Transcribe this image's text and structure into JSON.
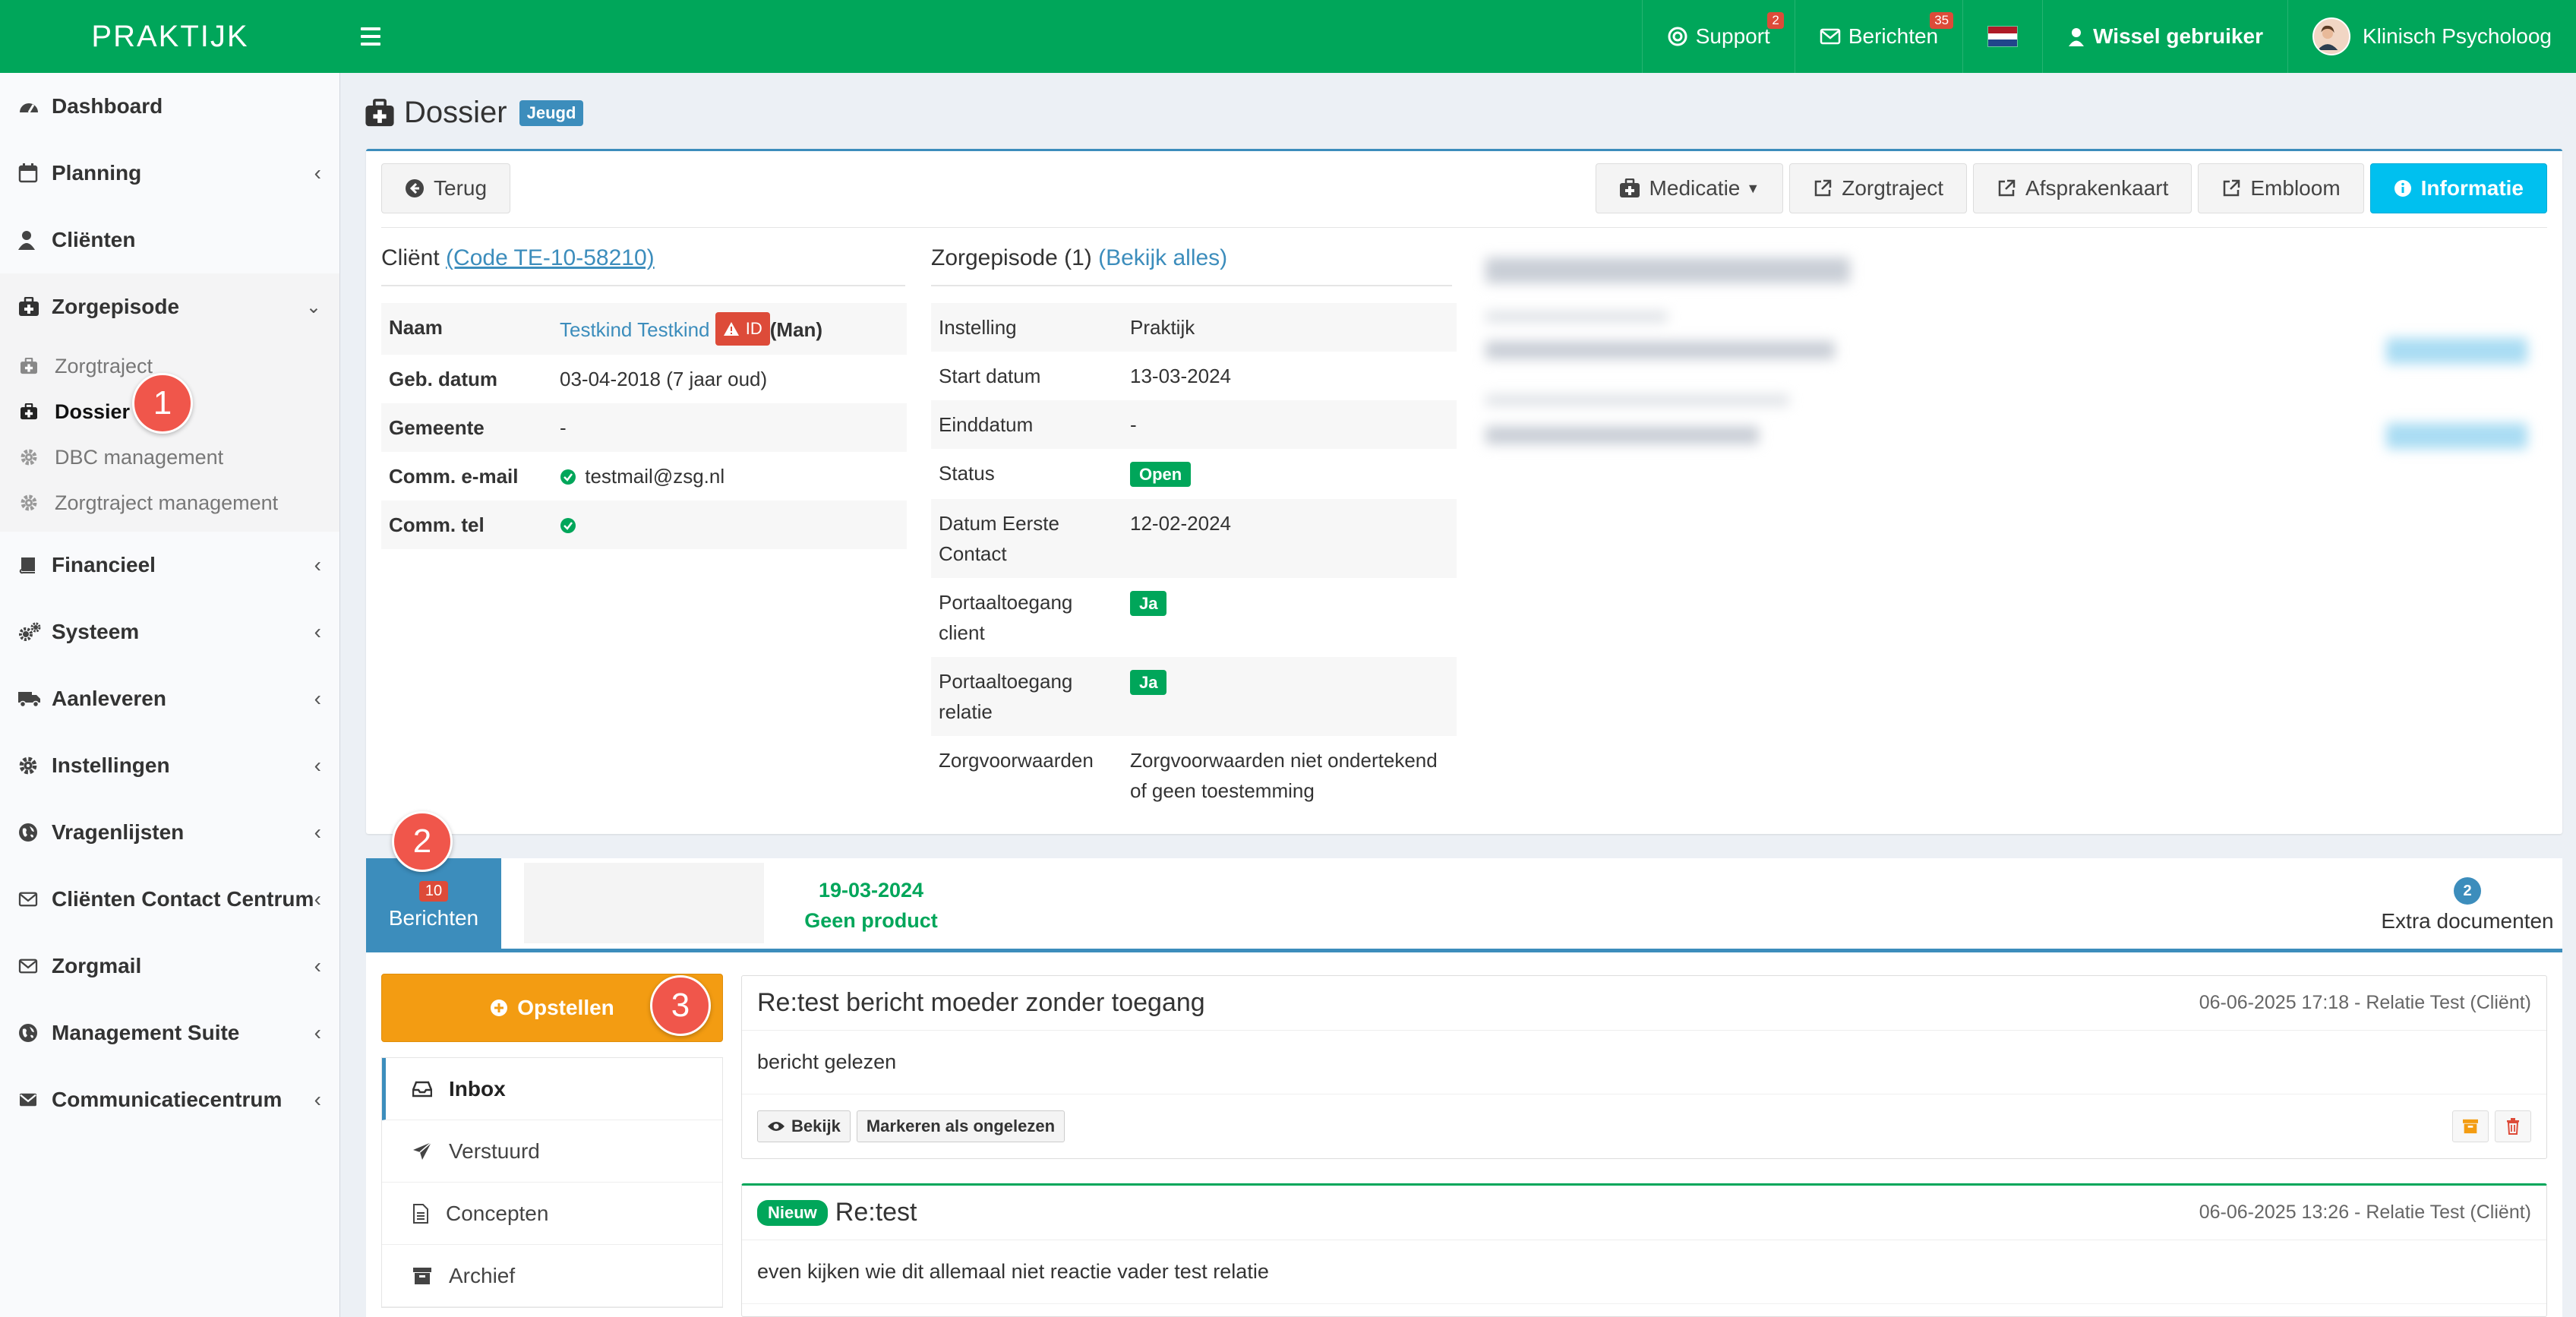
{
  "header": {
    "brand": "PRAKTIJK",
    "support_label": "Support",
    "support_badge": "2",
    "berichten_label": "Berichten",
    "berichten_badge": "35",
    "switch_user_label": "Wissel gebruiker",
    "user_role": "Klinisch Psycholoog"
  },
  "sidebar": {
    "items": [
      {
        "label": "Dashboard",
        "icon": "dashboard-icon"
      },
      {
        "label": "Planning",
        "icon": "calendar-icon"
      },
      {
        "label": "Cliënten",
        "icon": "user-icon"
      },
      {
        "label": "Zorgepisode",
        "icon": "medkit-icon"
      },
      {
        "label": "Financieel",
        "icon": "book-icon"
      },
      {
        "label": "Systeem",
        "icon": "cogs-icon"
      },
      {
        "label": "Aanleveren",
        "icon": "truck-icon"
      },
      {
        "label": "Instellingen",
        "icon": "gear-icon"
      },
      {
        "label": "Vragenlijsten",
        "icon": "globe-icon"
      },
      {
        "label": "Cliënten Contact Centrum",
        "icon": "envelope-icon"
      },
      {
        "label": "Zorgmail",
        "icon": "envelope-icon"
      },
      {
        "label": "Management Suite",
        "icon": "globe-icon"
      },
      {
        "label": "Communicatiecentrum",
        "icon": "envelope-icon"
      }
    ],
    "subitems": [
      {
        "label": "Zorgtraject"
      },
      {
        "label": "Dossier"
      },
      {
        "label": "DBC management"
      },
      {
        "label": "Zorgtraject management"
      }
    ]
  },
  "steps": [
    "1",
    "2",
    "3"
  ],
  "page": {
    "title": "Dossier",
    "label": "Jeugd"
  },
  "toolbar": {
    "back": "Terug",
    "medicatie": "Medicatie",
    "zorgtraject": "Zorgtraject",
    "afsprakenkaart": "Afsprakenkaart",
    "embloom": "Embloom",
    "informatie": "Informatie"
  },
  "client": {
    "title": "Cliënt",
    "code": "(Code TE-10-58210)",
    "rows": [
      {
        "label": "Naam",
        "value": "Testkind Testkind"
      },
      {
        "label": "Geb. datum",
        "value": "03-04-2018 (7 jaar oud)"
      },
      {
        "label": "Gemeente",
        "value": "-"
      },
      {
        "label": "Comm. e-mail",
        "value": "testmail@zsg.nl"
      },
      {
        "label": "Comm. tel",
        "value": ""
      }
    ],
    "id_badge": "ID",
    "gender": "(Man)"
  },
  "zorgepisode": {
    "title": "Zorgepisode (1)",
    "link": "(Bekijk alles)",
    "rows": [
      {
        "label": "Instelling",
        "value": "Praktijk"
      },
      {
        "label": "Start datum",
        "value": "13-03-2024"
      },
      {
        "label": "Einddatum",
        "value": "-"
      },
      {
        "label": "Status",
        "value": "Open"
      },
      {
        "label": "Datum Eerste Contact",
        "value": "12-02-2024"
      },
      {
        "label": "Portaaltoegang client",
        "value": "Ja"
      },
      {
        "label": "Portaaltoegang relatie",
        "value": "Ja"
      },
      {
        "label": "Zorgvoorwaarden",
        "value": "Zorgvoorwaarden niet ondertekend of geen toestemming"
      }
    ]
  },
  "tabs": {
    "berichten_count": "10",
    "berichten_label": "Berichten",
    "product_date": "19-03-2024",
    "product_label": "Geen product",
    "extra_count": "2",
    "extra_label": "Extra documenten"
  },
  "compose": {
    "label": "Opstellen"
  },
  "folders": [
    {
      "label": "Inbox"
    },
    {
      "label": "Verstuurd"
    },
    {
      "label": "Concepten"
    },
    {
      "label": "Archief"
    }
  ],
  "messages": [
    {
      "subject": "Re:test bericht moeder zonder toegang",
      "meta": "06-06-2025 17:18 - Relatie Test (Cliënt)",
      "body": "bericht gelezen",
      "view": "Bekijk",
      "mark_unread": "Markeren als ongelezen"
    },
    {
      "badge": "Nieuw",
      "subject": "Re:test",
      "meta": "06-06-2025 13:26 - Relatie Test (Cliënt)",
      "body": "even kijken wie dit allemaal niet reactie vader test relatie"
    }
  ],
  "colors": {
    "brand_green": "#00a65a",
    "primary_blue": "#3c8dbc",
    "orange": "#f39c12",
    "danger": "#dd4b39",
    "info": "#00c0ef"
  }
}
